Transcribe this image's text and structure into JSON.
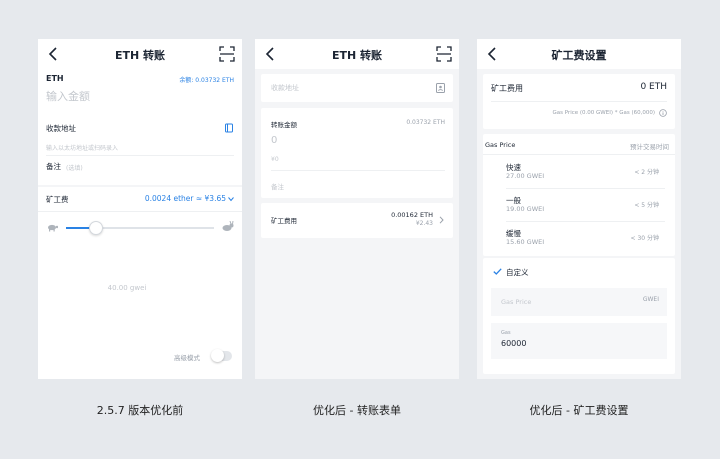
{
  "captions": [
    "2.5.7 版本优化前",
    "优化后 - 转账表单",
    "优化后 - 矿工费设置"
  ],
  "screen1": {
    "title": "ETH 转账",
    "token": "ETH",
    "balance": "余额: 0.03732 ETH",
    "amount_placeholder": "输入金额",
    "address_label": "收款地址",
    "address_placeholder": "输入以太坊地址或扫码录入",
    "note_label": "备注",
    "note_placeholder": "(选填)",
    "fee_label": "矿工费",
    "fee_value": "0.0024 ether ≈ ¥3.65",
    "gas_value": "40.00 gwei",
    "advanced_label": "高级模式",
    "slider_percent": 20
  },
  "screen2": {
    "title": "ETH 转账",
    "address_placeholder": "收款地址",
    "amount_label": "转账金额",
    "balance": "0.03732 ETH",
    "amount_value": "0",
    "fiat_value": "¥0",
    "note_placeholder": "备注",
    "fee_label": "矿工费用",
    "fee_eth": "0.00162 ETH",
    "fee_cny": "¥2.43"
  },
  "screen3": {
    "title": "矿工费设置",
    "fee_label": "矿工费用",
    "fee_value": "0 ETH",
    "formula": "Gas Price (0.00 GWEI) * Gas (60,000)",
    "col_gas_price": "Gas Price",
    "col_time": "预计交易时间",
    "options": [
      {
        "name": "快速",
        "price": "27.00 GWEI",
        "time": "< 2 分钟"
      },
      {
        "name": "一般",
        "price": "19.00 GWEI",
        "time": "< 5 分钟"
      },
      {
        "name": "缓慢",
        "price": "15.60 GWEI",
        "time": "< 30 分钟"
      }
    ],
    "custom_label": "自定义",
    "gas_price_placeholder": "Gas Price",
    "gas_price_unit": "GWEI",
    "gas_label": "Gas",
    "gas_value": "60000"
  }
}
